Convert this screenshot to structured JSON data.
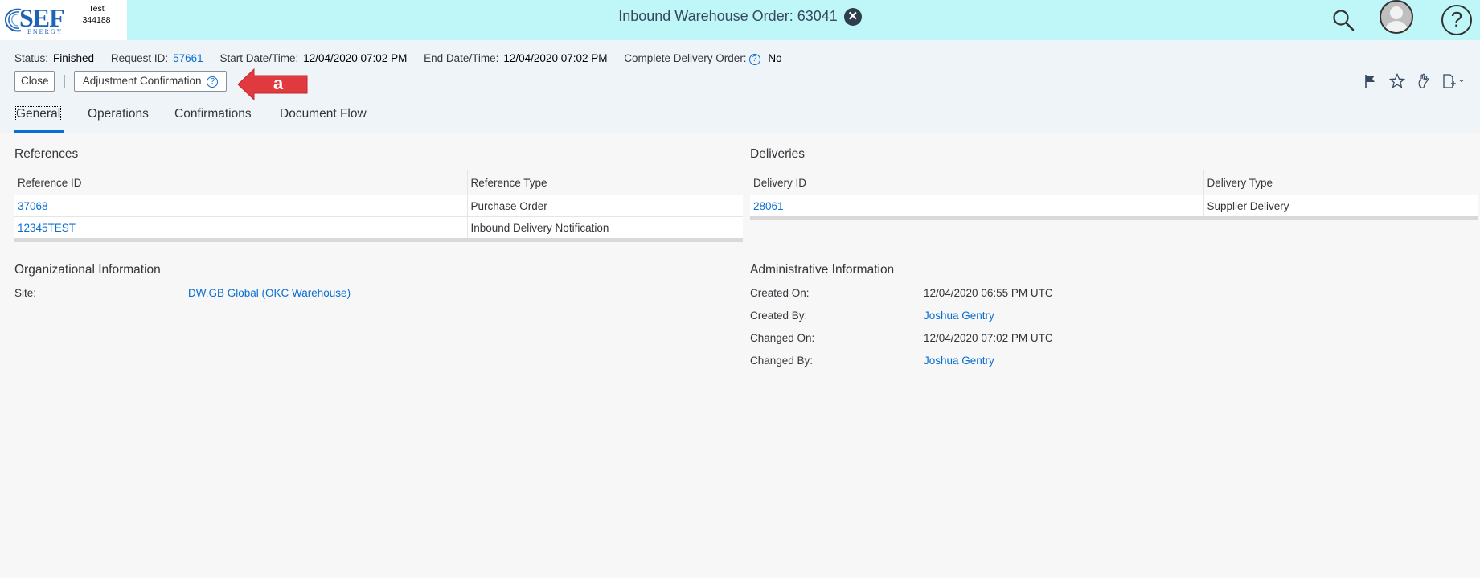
{
  "shell": {
    "logo_text": "SEF",
    "logo_subtext": "ENERGY",
    "system_line1": "Test",
    "system_line2": "344188",
    "title": "Inbound Warehouse Order: 63041",
    "title_close_icon": "close-circle-icon",
    "search_icon": "search-icon",
    "avatar_icon": "user-avatar-icon",
    "help_label": "?"
  },
  "header": {
    "attributes": [
      {
        "label": "Status:",
        "value": "Finished"
      },
      {
        "label": "Request ID:",
        "value": "57661"
      },
      {
        "label": "Start Date/Time:",
        "value": "12/04/2020 07:02 PM"
      },
      {
        "label": "End Date/Time:",
        "value": "12/04/2020 07:02 PM"
      },
      {
        "label": "Complete Delivery Order:",
        "value": "No"
      }
    ],
    "help_glyph": "?",
    "buttons": {
      "close": "Close",
      "adjustment": "Adjustment Confirmation"
    },
    "callout_label": "a",
    "actions": [
      "flag-icon",
      "favorite-icon",
      "bookmark-icon",
      "add-page-icon"
    ],
    "dropdown_glyph": "⌄"
  },
  "tabs": [
    {
      "label": "General",
      "active": true
    },
    {
      "label": "Operations",
      "active": false
    },
    {
      "label": "Confirmations",
      "active": false
    },
    {
      "label": "Document Flow",
      "active": false
    }
  ],
  "references": {
    "title": "References",
    "columns": [
      "Reference ID",
      "Reference Type"
    ],
    "rows": [
      [
        "37068",
        "Purchase Order"
      ],
      [
        "12345TEST",
        "Inbound Delivery Notification"
      ]
    ]
  },
  "deliveries": {
    "title": "Deliveries",
    "columns": [
      "Delivery ID",
      "Delivery Type"
    ],
    "rows": [
      [
        "28061",
        "Supplier Delivery"
      ]
    ]
  },
  "organizational": {
    "title": "Organizational Information",
    "site_label": "Site:",
    "site_value": "DW.GB Global (OKC Warehouse)"
  },
  "administrative": {
    "title": "Administrative Information",
    "created_on_label": "Created On:",
    "created_on_value": "12/04/2020 06:55 PM UTC",
    "created_by_label": "Created By:",
    "created_by_value": "Joshua Gentry",
    "changed_on_label": "Changed On:",
    "changed_on_value": "12/04/2020 07:02 PM UTC",
    "changed_by_label": "Changed By:",
    "changed_by_value": "Joshua Gentry"
  },
  "colors": {
    "shell_bg": "#bff6f8",
    "link": "#0a6ed1",
    "callout_red": "#e03a3e"
  }
}
